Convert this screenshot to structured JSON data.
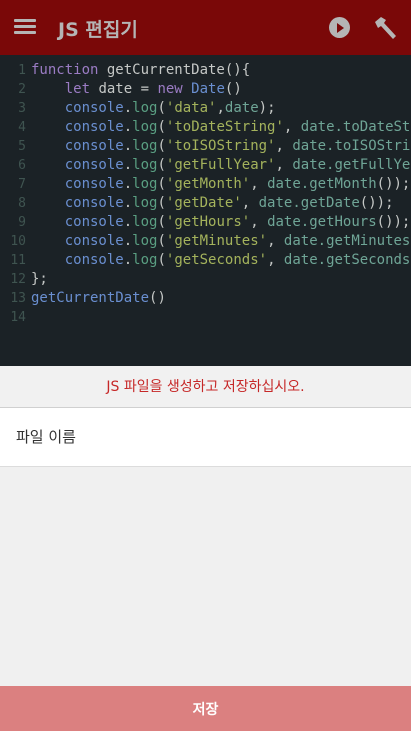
{
  "header": {
    "title": "JS 편집기",
    "menu_icon": "hamburger-icon",
    "run_icon": "play-circle-icon",
    "build_icon": "hammer-icon"
  },
  "editor": {
    "lines": [
      {
        "n": "1",
        "tokens": [
          [
            "k",
            "function "
          ],
          [
            "f",
            "getCurrentDate"
          ],
          [
            "p",
            "(){"
          ]
        ]
      },
      {
        "n": "2",
        "tokens": [
          [
            "p",
            "    "
          ],
          [
            "k",
            "let "
          ],
          [
            "f",
            "date = "
          ],
          [
            "k",
            "new "
          ],
          [
            "o",
            "Date"
          ],
          [
            "p",
            "()"
          ]
        ]
      },
      {
        "n": "3",
        "tokens": [
          [
            "p",
            "    "
          ],
          [
            "o",
            "console"
          ],
          [
            "p",
            "."
          ],
          [
            "m",
            "log"
          ],
          [
            "p",
            "("
          ],
          [
            "s",
            "'data'"
          ],
          [
            "p",
            ","
          ],
          [
            "v",
            "date"
          ],
          [
            "p",
            ");"
          ]
        ]
      },
      {
        "n": "4",
        "tokens": [
          [
            "p",
            "    "
          ],
          [
            "o",
            "console"
          ],
          [
            "p",
            "."
          ],
          [
            "m",
            "log"
          ],
          [
            "p",
            "("
          ],
          [
            "s",
            "'toDateString'"
          ],
          [
            "p",
            ", "
          ],
          [
            "v",
            "date.toDateString"
          ],
          [
            "p",
            "());"
          ]
        ]
      },
      {
        "n": "5",
        "tokens": [
          [
            "p",
            "    "
          ],
          [
            "o",
            "console"
          ],
          [
            "p",
            "."
          ],
          [
            "m",
            "log"
          ],
          [
            "p",
            "("
          ],
          [
            "s",
            "'toISOString'"
          ],
          [
            "p",
            ", "
          ],
          [
            "v",
            "date.toISOString"
          ],
          [
            "p",
            "());"
          ]
        ]
      },
      {
        "n": "6",
        "tokens": [
          [
            "p",
            "    "
          ],
          [
            "o",
            "console"
          ],
          [
            "p",
            "."
          ],
          [
            "m",
            "log"
          ],
          [
            "p",
            "("
          ],
          [
            "s",
            "'getFullYear'"
          ],
          [
            "p",
            ", "
          ],
          [
            "v",
            "date.getFullYear"
          ],
          [
            "p",
            "());"
          ]
        ]
      },
      {
        "n": "7",
        "tokens": [
          [
            "p",
            "    "
          ],
          [
            "o",
            "console"
          ],
          [
            "p",
            "."
          ],
          [
            "m",
            "log"
          ],
          [
            "p",
            "("
          ],
          [
            "s",
            "'getMonth'"
          ],
          [
            "p",
            ", "
          ],
          [
            "v",
            "date.getMonth"
          ],
          [
            "p",
            "());"
          ]
        ]
      },
      {
        "n": "8",
        "tokens": [
          [
            "p",
            "    "
          ],
          [
            "o",
            "console"
          ],
          [
            "p",
            "."
          ],
          [
            "m",
            "log"
          ],
          [
            "p",
            "("
          ],
          [
            "s",
            "'getDate'"
          ],
          [
            "p",
            ", "
          ],
          [
            "v",
            "date.getDate"
          ],
          [
            "p",
            "());"
          ]
        ]
      },
      {
        "n": "9",
        "tokens": [
          [
            "p",
            "    "
          ],
          [
            "o",
            "console"
          ],
          [
            "p",
            "."
          ],
          [
            "m",
            "log"
          ],
          [
            "p",
            "("
          ],
          [
            "s",
            "'getHours'"
          ],
          [
            "p",
            ", "
          ],
          [
            "v",
            "date.getHours"
          ],
          [
            "p",
            "());"
          ]
        ]
      },
      {
        "n": "10",
        "tokens": [
          [
            "p",
            "    "
          ],
          [
            "o",
            "console"
          ],
          [
            "p",
            "."
          ],
          [
            "m",
            "log"
          ],
          [
            "p",
            "("
          ],
          [
            "s",
            "'getMinutes'"
          ],
          [
            "p",
            ", "
          ],
          [
            "v",
            "date.getMinutes"
          ],
          [
            "p",
            "());"
          ]
        ]
      },
      {
        "n": "11",
        "tokens": [
          [
            "p",
            "    "
          ],
          [
            "o",
            "console"
          ],
          [
            "p",
            "."
          ],
          [
            "m",
            "log"
          ],
          [
            "p",
            "("
          ],
          [
            "s",
            "'getSeconds'"
          ],
          [
            "p",
            ", "
          ],
          [
            "v",
            "date.getSeconds"
          ],
          [
            "p",
            "());"
          ]
        ]
      },
      {
        "n": "12",
        "tokens": [
          [
            "p",
            "};"
          ]
        ]
      },
      {
        "n": "13",
        "tokens": [
          [
            "o",
            "getCurrentDate"
          ],
          [
            "p",
            "()"
          ]
        ]
      },
      {
        "n": "14",
        "tokens": []
      }
    ]
  },
  "message": "JS 파일을 생성하고 저장하십시오.",
  "filename": {
    "value": "",
    "placeholder": "파일 이름"
  },
  "save_label": "저장",
  "colors": {
    "header": "#7a0808",
    "editor_bg": "#1b2226",
    "message": "#c62828",
    "save_button": "#db8080"
  }
}
